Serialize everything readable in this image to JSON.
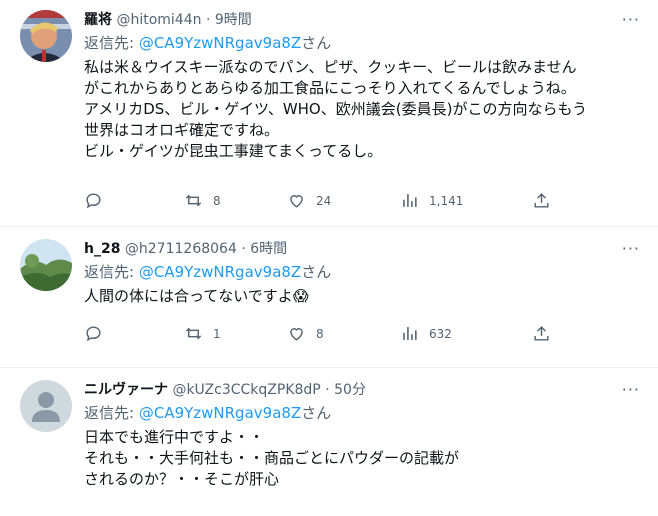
{
  "tweets": [
    {
      "name": "羅将",
      "handle": "@hitomi44n",
      "time": "9時間",
      "reply_prefix": "返信先: ",
      "reply_handle": "@CA9YzwNRgav9a8Z",
      "reply_suffix": "さん",
      "lines": [
        "私は米＆ウイスキー派なのでパン、ピザ、クッキー、ビールは飲みません",
        "がこれからありとあらゆる加工食品にこっそり入れてくるんでしょうね。",
        "アメリカDS、ビル・ゲイツ、WHO、欧州議会(委員長)がこの方向ならもう",
        "世界はコオロギ確定ですね。",
        "ビル・ゲイツが昆虫工事建てまくってるし。"
      ],
      "retweets": "8",
      "likes": "24",
      "views": "1,141",
      "avatar_icon": "profile-photo"
    },
    {
      "name": "h_28",
      "handle": "@h2711268064",
      "time": "6時間",
      "reply_prefix": "返信先: ",
      "reply_handle": "@CA9YzwNRgav9a8Z",
      "reply_suffix": "さん",
      "lines": [
        "人間の体には合ってないですよ"
      ],
      "emoji": "😱",
      "retweets": "1",
      "likes": "8",
      "views": "632",
      "avatar_icon": "landscape-photo"
    },
    {
      "name": "ニルヴァーナ",
      "handle": "@kUZc3CCkqZPK8dP",
      "time": "50分",
      "reply_prefix": "返信先: ",
      "reply_handle": "@CA9YzwNRgav9a8Z",
      "reply_suffix": "さん",
      "lines": [
        "日本でも進行中ですよ・・",
        "それも・・大手何社も・・商品ごとにパウダーの記載が",
        "されるのか？・・そこが肝心"
      ],
      "avatar_icon": "default-user-silhouette"
    }
  ],
  "more_label": "···",
  "separator": "·",
  "colors": {
    "link": "#1d9bf0",
    "muted": "#536471",
    "text": "#0f1419"
  }
}
